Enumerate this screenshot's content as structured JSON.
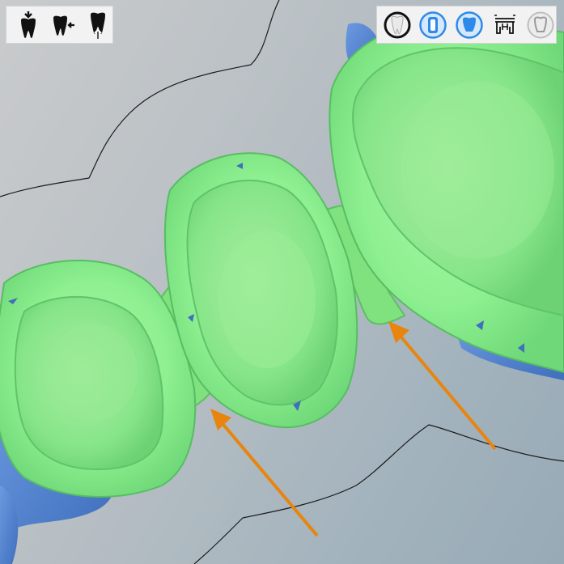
{
  "app": {
    "view": "dental-cad-3d-viewport"
  },
  "toolbar_left": {
    "buttons": [
      {
        "icon": "tooth-insertion-direction-icon"
      },
      {
        "icon": "tooth-move-adjacent-icon"
      },
      {
        "icon": "tooth-root-up-icon"
      }
    ]
  },
  "toolbar_right": {
    "buttons": [
      {
        "icon": "margin-line-ring-icon",
        "active": true
      },
      {
        "icon": "die-icon",
        "active": true
      },
      {
        "icon": "crown-icon",
        "active": true
      },
      {
        "icon": "bridge-connector-icon",
        "active": false
      },
      {
        "icon": "crown-outline-icon",
        "active": false
      }
    ]
  },
  "colors": {
    "model_green": "#8ef090",
    "model_green_dark": "#5fc46a",
    "scan_blue": "#4f7fcc",
    "arrow_orange": "#e8850f",
    "accent_blue": "#2d8ae8"
  }
}
